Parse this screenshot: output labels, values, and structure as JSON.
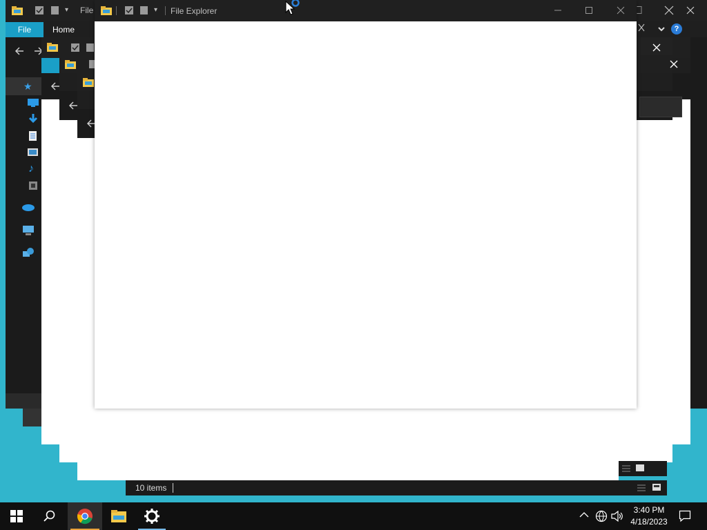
{
  "windows": {
    "back1": {
      "title": "File",
      "ribbon_tabs": {
        "file": "File",
        "home": "Home"
      }
    },
    "front": {
      "title": "File Explorer"
    }
  },
  "statusbar": {
    "items_count": "10 items"
  },
  "taskbar": {
    "time": "3:40 PM",
    "date": "4/18/2023"
  },
  "colors": {
    "desktop": "#31b5cc",
    "window_dark": "#191919",
    "accent": "#1a9fc7",
    "selected_tab": "#0f6ea5"
  }
}
